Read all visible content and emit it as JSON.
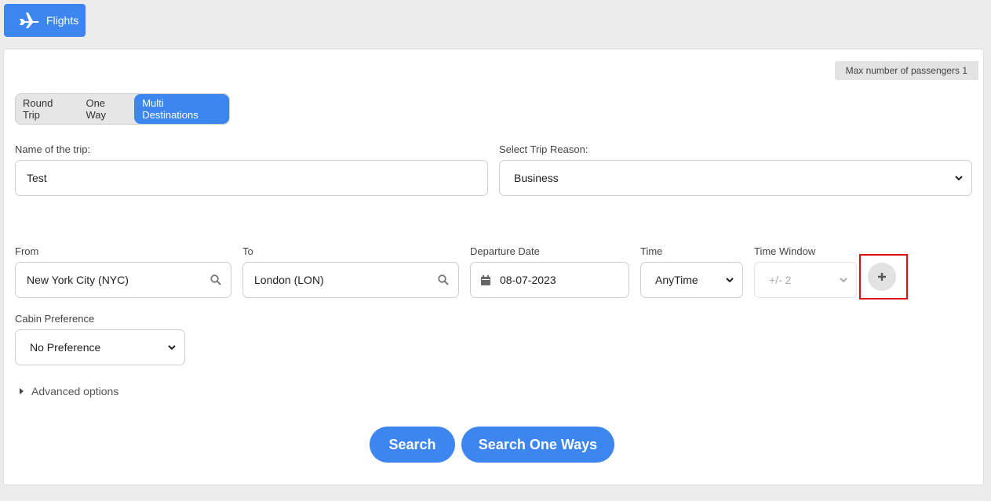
{
  "top_tab": {
    "label": "Flights",
    "icon": "airplane-icon"
  },
  "max_passengers": "Max number of passengers 1",
  "trip_types": [
    "Round Trip",
    "One Way",
    "Multi Destinations"
  ],
  "trip_types_active": "Multi Destinations",
  "trip_name": {
    "label": "Name of the trip:",
    "value": "Test"
  },
  "trip_reason": {
    "label": "Select Trip Reason:",
    "value": "Business"
  },
  "leg": {
    "from": {
      "label": "From",
      "value": "New York City (NYC)"
    },
    "to": {
      "label": "To",
      "value": "London (LON)"
    },
    "departure_date": {
      "label": "Departure Date",
      "value": "08-07-2023"
    },
    "time": {
      "label": "Time",
      "value": "AnyTime"
    },
    "time_window": {
      "label": "Time Window",
      "value": "+/- 2"
    }
  },
  "add_leg_icon": "plus-icon",
  "cabin": {
    "label": "Cabin Preference",
    "value": "No Preference"
  },
  "advanced_options": "Advanced options",
  "buttons": {
    "search": "Search",
    "search_one_ways": "Search One Ways"
  },
  "colors": {
    "accent": "#3d86f0",
    "highlight": "#e01010"
  }
}
